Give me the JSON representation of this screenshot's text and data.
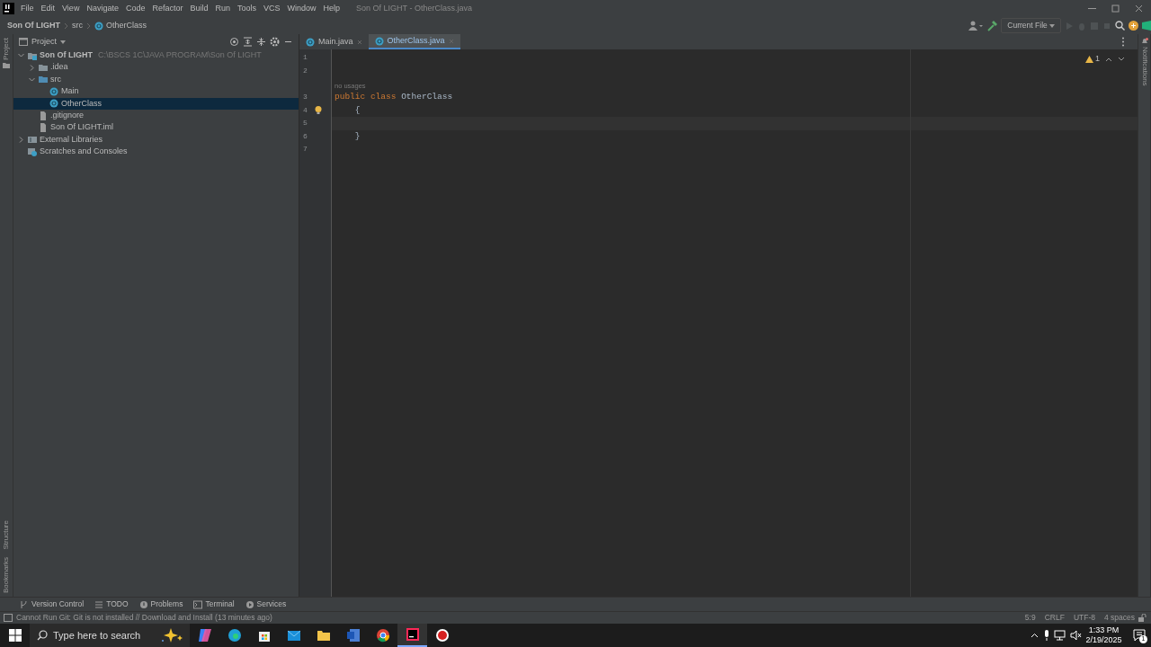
{
  "menu": [
    "File",
    "Edit",
    "View",
    "Navigate",
    "Code",
    "Refactor",
    "Build",
    "Run",
    "Tools",
    "VCS",
    "Window",
    "Help"
  ],
  "window_title": "Son Of LIGHT - OtherClass.java",
  "breadcrumbs": [
    {
      "label": "Son Of LIGHT",
      "kind": "project"
    },
    {
      "label": "src",
      "kind": "folder"
    },
    {
      "label": "OtherClass",
      "kind": "class"
    }
  ],
  "run_config": "Current File",
  "left_stripe": [
    "Project",
    "Structure",
    "Bookmarks"
  ],
  "right_stripe": [
    "Notifications"
  ],
  "project_panel": {
    "title": "Project",
    "tree": [
      {
        "label": "Son Of LIGHT",
        "path": "C:\\BSCS 1C\\JAVA PROGRAM\\Son Of LIGHT",
        "kind": "module",
        "expanded": true,
        "selected": false,
        "children": [
          {
            "label": ".idea",
            "kind": "folder",
            "expanded": false,
            "selected": false
          },
          {
            "label": "src",
            "kind": "source",
            "expanded": true,
            "selected": false,
            "children": [
              {
                "label": "Main",
                "kind": "class",
                "selected": false
              },
              {
                "label": "OtherClass",
                "kind": "class",
                "selected": true
              }
            ]
          },
          {
            "label": ".gitignore",
            "kind": "file",
            "selected": false
          },
          {
            "label": "Son Of LIGHT.iml",
            "kind": "file",
            "selected": false
          }
        ]
      },
      {
        "label": "External Libraries",
        "kind": "library",
        "expanded": false,
        "selected": false
      },
      {
        "label": "Scratches and Consoles",
        "kind": "scratches",
        "selected": false
      }
    ]
  },
  "tabs": [
    {
      "label": "Main.java",
      "selected": false
    },
    {
      "label": "OtherClass.java",
      "selected": true
    }
  ],
  "editor": {
    "warnings": "1",
    "lines": [
      {
        "number": "1"
      },
      {
        "number": "2"
      },
      {
        "number": "3",
        "inlay": "no usages",
        "tokens": [
          {
            "text": "public class ",
            "kind": "keyword"
          },
          {
            "text": "OtherClass",
            "kind": "name"
          }
        ]
      },
      {
        "number": "4",
        "bulb": true,
        "tokens": [
          {
            "text": "    {",
            "kind": "plain"
          }
        ]
      },
      {
        "number": "5",
        "current": true
      },
      {
        "number": "6",
        "tokens": [
          {
            "text": "    }",
            "kind": "plain"
          }
        ]
      },
      {
        "number": "7"
      }
    ]
  },
  "tool_tabs": [
    {
      "label": "Version Control",
      "kind": "vcs"
    },
    {
      "label": "TODO",
      "kind": "todo"
    },
    {
      "label": "Problems",
      "kind": "problems"
    },
    {
      "label": "Terminal",
      "kind": "terminal"
    },
    {
      "label": "Services",
      "kind": "services"
    }
  ],
  "status_message": "Cannot Run Git: Git is not installed // Download and Install (13 minutes ago)",
  "status_items": [
    "5:9",
    "CRLF",
    "UTF-8",
    "4 spaces"
  ],
  "taskbar": {
    "search_placeholder": "Type here to search",
    "apps": [
      {
        "kind": "copilot",
        "selected": false
      },
      {
        "kind": "edge",
        "selected": false
      },
      {
        "kind": "store",
        "selected": false
      },
      {
        "kind": "mail",
        "selected": false
      },
      {
        "kind": "folder",
        "selected": false
      },
      {
        "kind": "word",
        "selected": false
      },
      {
        "kind": "chrome",
        "selected": false
      },
      {
        "kind": "ide",
        "selected": true
      },
      {
        "kind": "record",
        "selected": false
      }
    ],
    "time": "1:33 PM",
    "date": "2/19/2025",
    "notifications": "1"
  }
}
